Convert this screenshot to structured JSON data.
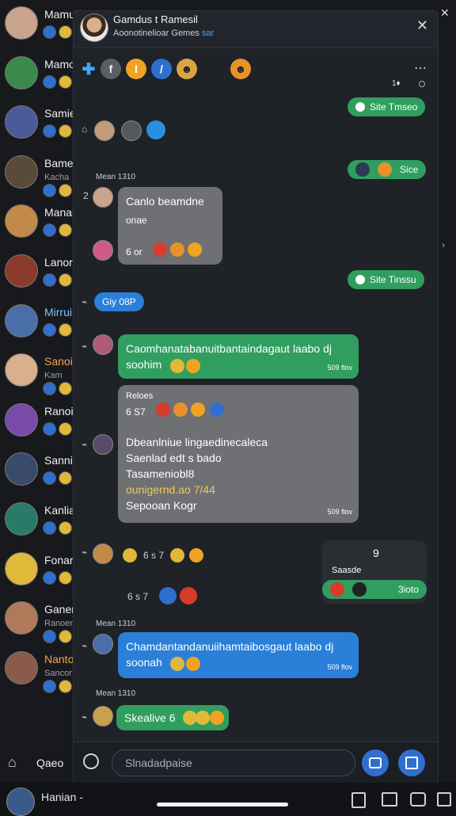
{
  "sidebar": {
    "chats": [
      {
        "name": "Mamulizaic",
        "sub": "",
        "name_color": "#f0f0f0"
      },
      {
        "name": "Mamo",
        "sub": "",
        "name_color": "#f0f0f0"
      },
      {
        "name": "Samie",
        "sub": "",
        "name_color": "#f0f0f0"
      },
      {
        "name": "Bame",
        "sub": "Kacha",
        "name_color": "#f0f0f0"
      },
      {
        "name": "Manai",
        "sub": "",
        "name_color": "#f0f0f0"
      },
      {
        "name": "Lanor",
        "sub": "",
        "name_color": "#f0f0f0"
      },
      {
        "name": "Mirrui",
        "sub": "",
        "name_color": "#7cc0ff"
      },
      {
        "name": "Sanoi",
        "sub": "Kam",
        "name_color": "#f7a64a"
      },
      {
        "name": "Ranoi",
        "sub": "",
        "name_color": "#f0f0f0"
      },
      {
        "name": "Sanni",
        "sub": "",
        "name_color": "#f0f0f0"
      },
      {
        "name": "Kanlia",
        "sub": "",
        "name_color": "#f0f0f0"
      },
      {
        "name": "Fonar",
        "sub": "",
        "name_color": "#f0f0f0"
      },
      {
        "name": "Ganer",
        "sub": "Ranoer",
        "name_color": "#f0f0f0"
      },
      {
        "name": "Nanto",
        "sub": "Sancor",
        "name_color": "#f7a64a"
      }
    ],
    "bottom_label": "Qaeo",
    "footer_name": "Hanian -"
  },
  "modal": {
    "title": "Gamdus t Ramesil",
    "subtitle": "Aoonotinelioar Gemes",
    "subtitle_accent": "sar",
    "close_label": "✕",
    "more_label": "⋯",
    "top_counter": "1♦",
    "sent_pill_1": "Site Tmseo",
    "sent_pill_2": "Sice",
    "sent_pill_3": "Site Tinssu",
    "date_1": "Mean 1310",
    "gray_card_1": {
      "line1": "Canlo beamdne",
      "line2": "onae",
      "count": "6 or"
    },
    "blue_pill": "Giy 08P",
    "green_long": {
      "text": "Caomhanatabanuitbantaindagaut laabo dj soohim",
      "time": "509 flov"
    },
    "gray_card_2": {
      "head": "Reloes",
      "count": "6 S7",
      "line1": "Dbeanlniue lingaedinecaleca",
      "line2": "Saenlad edt s bado",
      "line3": "Tasameniobl8",
      "line4": "ounigernd.ao 7/44",
      "line5": "Sepooan Kogr",
      "time": "509 flov"
    },
    "side_card": {
      "count": "9",
      "label": "Saasde",
      "pill": "3ioto"
    },
    "reaction_row_label": "6 s 7",
    "reaction_row_2": "6 s 7",
    "date_2": "Mean 1310",
    "blue_long": {
      "text": "Chamdantandanuiihamtaibosgaut laabo dj soonah",
      "time": "509 flov"
    },
    "date_3": "Mean 1310",
    "green_short": "Skealive 6",
    "input_placeholder": "Slnadadpaise"
  },
  "colors": {
    "green": "#2f9e5f",
    "blue": "#2a7fd8",
    "gray": "#6e7074",
    "accent": "#3ea6ff"
  }
}
